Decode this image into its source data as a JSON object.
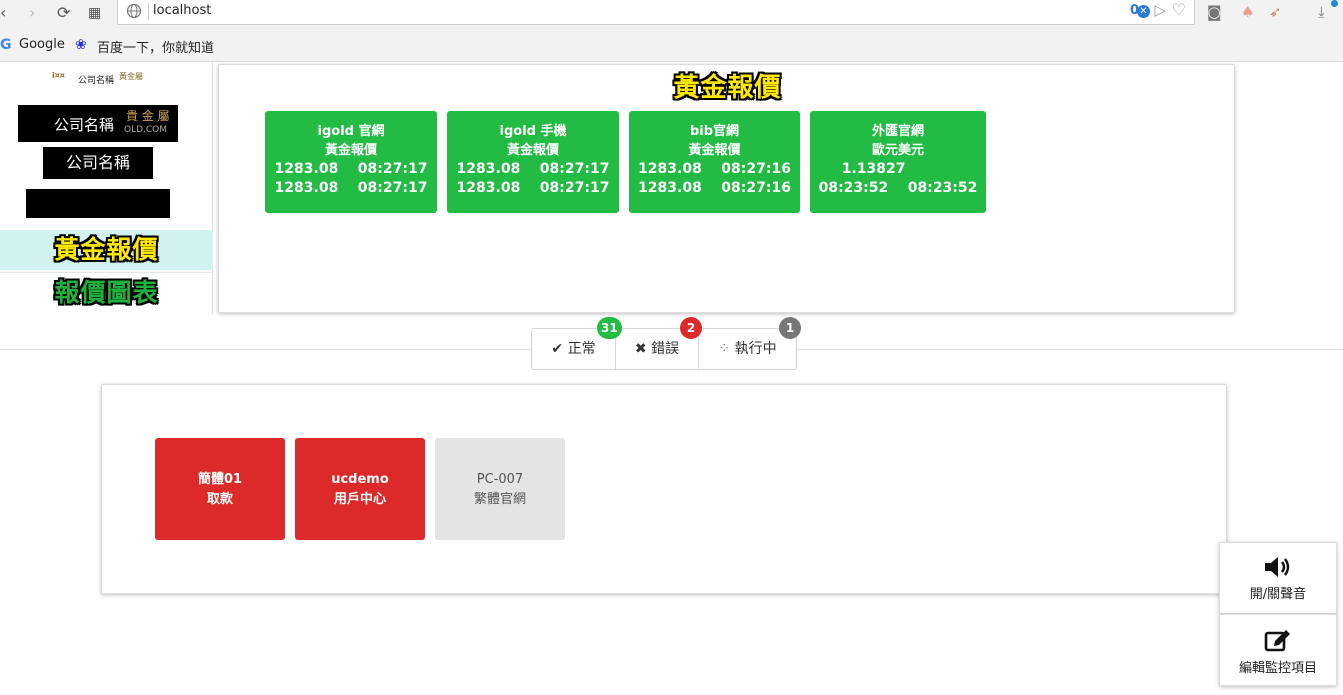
{
  "browser": {
    "url": "localhost",
    "badge_count": "0",
    "bookmarks": [
      "Google",
      "百度一下，你就知道"
    ]
  },
  "sidebar": {
    "logos": [
      "公司名稱",
      "公司名稱",
      "公司名稱"
    ],
    "logo1_extra": "黃金屬",
    "logo2_extra": "貴 金 屬",
    "logo2_sub": "OLD.COM",
    "nav": [
      {
        "label": "黃金報價",
        "active": true
      },
      {
        "label": "報價圖表",
        "active": false
      }
    ]
  },
  "quotes": {
    "title": "黃金報價",
    "cards": [
      {
        "line1": "igold 官網",
        "line2": "黃金報價",
        "row1": "1283.08    08:27:17",
        "row2": "1283.08    08:27:17"
      },
      {
        "line1": "igold 手機",
        "line2": "黃金報價",
        "row1": "1283.08    08:27:17",
        "row2": "1283.08    08:27:17"
      },
      {
        "line1": "bib官網",
        "line2": "黃金報價",
        "row1": "1283.08    08:27:16",
        "row2": "1283.08    08:27:16"
      },
      {
        "line1": "外匯官網",
        "line2": "歐元美元",
        "row1": "1.13827          ",
        "row2": "08:23:52    08:23:52"
      }
    ]
  },
  "status": {
    "tabs": [
      {
        "label": "正常",
        "count": "31",
        "color": "#22bb44",
        "icon": "check-icon"
      },
      {
        "label": "錯誤",
        "count": "2",
        "color": "#dc2a2a",
        "icon": "cross-icon"
      },
      {
        "label": "執行中",
        "count": "1",
        "color": "#777777",
        "icon": "spinner-icon"
      }
    ]
  },
  "monitors": [
    {
      "line1": "簡體01",
      "line2": "取款",
      "state": "error"
    },
    {
      "line1": "ucdemo",
      "line2": "用戶中心",
      "state": "error"
    },
    {
      "line1": "PC-007",
      "line2": "繁體官網",
      "state": "idle"
    }
  ],
  "actions": {
    "sound_label": "開/關聲音",
    "edit_label": "編輯監控項目"
  }
}
